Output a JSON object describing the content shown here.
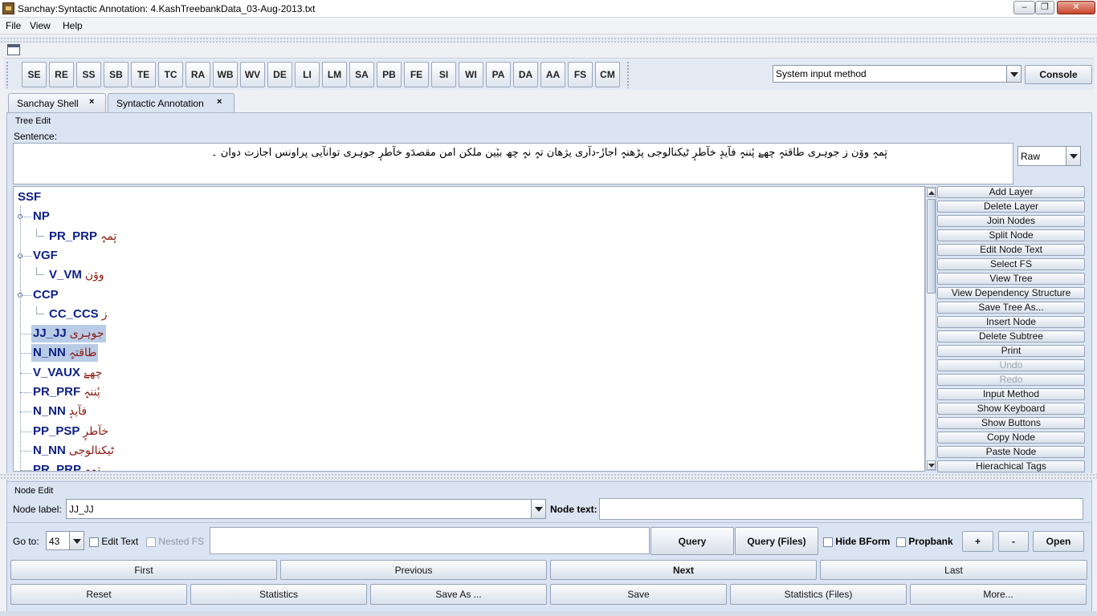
{
  "window": {
    "title": "Sanchay:Syntactic Annotation: 4.KashTreebankData_03-Aug-2013.txt",
    "minimize": "–",
    "maximize": "❐",
    "close": "✕"
  },
  "menu": [
    "File",
    "View",
    "Help"
  ],
  "toolbar": {
    "buttons": [
      "SE",
      "RE",
      "SS",
      "SB",
      "TE",
      "TC",
      "RA",
      "WB",
      "WV",
      "DE",
      "LI",
      "LM",
      "SA",
      "PB",
      "FE",
      "SI",
      "WI",
      "PA",
      "DA",
      "AA",
      "FS",
      "CM"
    ],
    "input_method": "System input method",
    "console": "Console"
  },
  "tabs": [
    {
      "label": "Sanchay Shell",
      "close": "×"
    },
    {
      "label": "Syntactic Annotation",
      "close": "×"
    }
  ],
  "tree_edit": {
    "group_title": "Tree Edit",
    "sentence_label": "Sentence:",
    "sentence": "تٕمہٕ ووٚن ز جوہری طاقتہٕ چھےٚ پٔننہٕ فآیدٕ خآطرٕ ٹیکنالوجی پڑھنہٕ اجازٔ-دآری یژھان تہٕ نہٕ چھ بیٚین ملکن امن مقصدَو خآطرٕ جوہری توانآیی پراونس اجازت دوان ۔",
    "format": "Raw"
  },
  "tree_nodes": [
    {
      "tag": "SSF",
      "word": ""
    },
    {
      "tag": "NP",
      "word": ""
    },
    {
      "tag": "PR_PRP",
      "word": "تٕمہٕ"
    },
    {
      "tag": "VGF",
      "word": ""
    },
    {
      "tag": "V_VM",
      "word": "ووٚن"
    },
    {
      "tag": "CCP",
      "word": ""
    },
    {
      "tag": "CC_CCS",
      "word": "ز"
    },
    {
      "tag": "JJ_JJ",
      "word": "جوہری"
    },
    {
      "tag": "N_NN",
      "word": "طاقتہٕ"
    },
    {
      "tag": "V_VAUX",
      "word": "چھےٚ"
    },
    {
      "tag": "PR_PRF",
      "word": "پٔننہٕ"
    },
    {
      "tag": "N_NN",
      "word": "فآیدٕ"
    },
    {
      "tag": "PP_PSP",
      "word": "خآطرٕ"
    },
    {
      "tag": "N_NN",
      "word": "ٹیکنالوجی"
    },
    {
      "tag": "PR_PRP",
      "word": "تٕمہٕ"
    }
  ],
  "side_buttons": [
    {
      "label": "Add Layer",
      "enabled": true
    },
    {
      "label": "Delete Layer",
      "enabled": true
    },
    {
      "label": "Join Nodes",
      "enabled": true
    },
    {
      "label": "Split Node",
      "enabled": true
    },
    {
      "label": "Edit Node Text",
      "enabled": true
    },
    {
      "label": "Select FS",
      "enabled": true
    },
    {
      "label": "View Tree",
      "enabled": true
    },
    {
      "label": "View Dependency Structure",
      "enabled": true
    },
    {
      "label": "Save Tree As...",
      "enabled": true
    },
    {
      "label": "Insert Node",
      "enabled": true
    },
    {
      "label": "Delete Subtree",
      "enabled": true
    },
    {
      "label": "Print",
      "enabled": true
    },
    {
      "label": "Undo",
      "enabled": false
    },
    {
      "label": "Redo",
      "enabled": false
    },
    {
      "label": "Input Method",
      "enabled": true
    },
    {
      "label": "Show Keyboard",
      "enabled": true
    },
    {
      "label": "Show Buttons",
      "enabled": true
    },
    {
      "label": "Copy Node",
      "enabled": true
    },
    {
      "label": "Paste Node",
      "enabled": true
    },
    {
      "label": "Hierachical Tags",
      "enabled": true
    }
  ],
  "node_edit": {
    "group_title": "Node Edit",
    "label_caption": "Node label:",
    "label_value": "JJ_JJ",
    "text_caption": "Node text:",
    "text_value": ""
  },
  "query_row": {
    "goto_label": "Go to:",
    "goto_value": "43",
    "edit_text": "Edit Text",
    "nested_fs": "Nested FS",
    "query_value": "",
    "query": "Query",
    "query_files": "Query (Files)",
    "hide_bform": "Hide BForm",
    "propbank": "Propbank",
    "plus": "+",
    "minus": "-",
    "open": "Open"
  },
  "nav": {
    "first": "First",
    "previous": "Previous",
    "next": "Next",
    "last": "Last"
  },
  "bottom": {
    "reset": "Reset",
    "statistics": "Statistics",
    "save_as": "Save As ...",
    "save": "Save",
    "statistics_files": "Statistics (Files)",
    "more": "More..."
  }
}
